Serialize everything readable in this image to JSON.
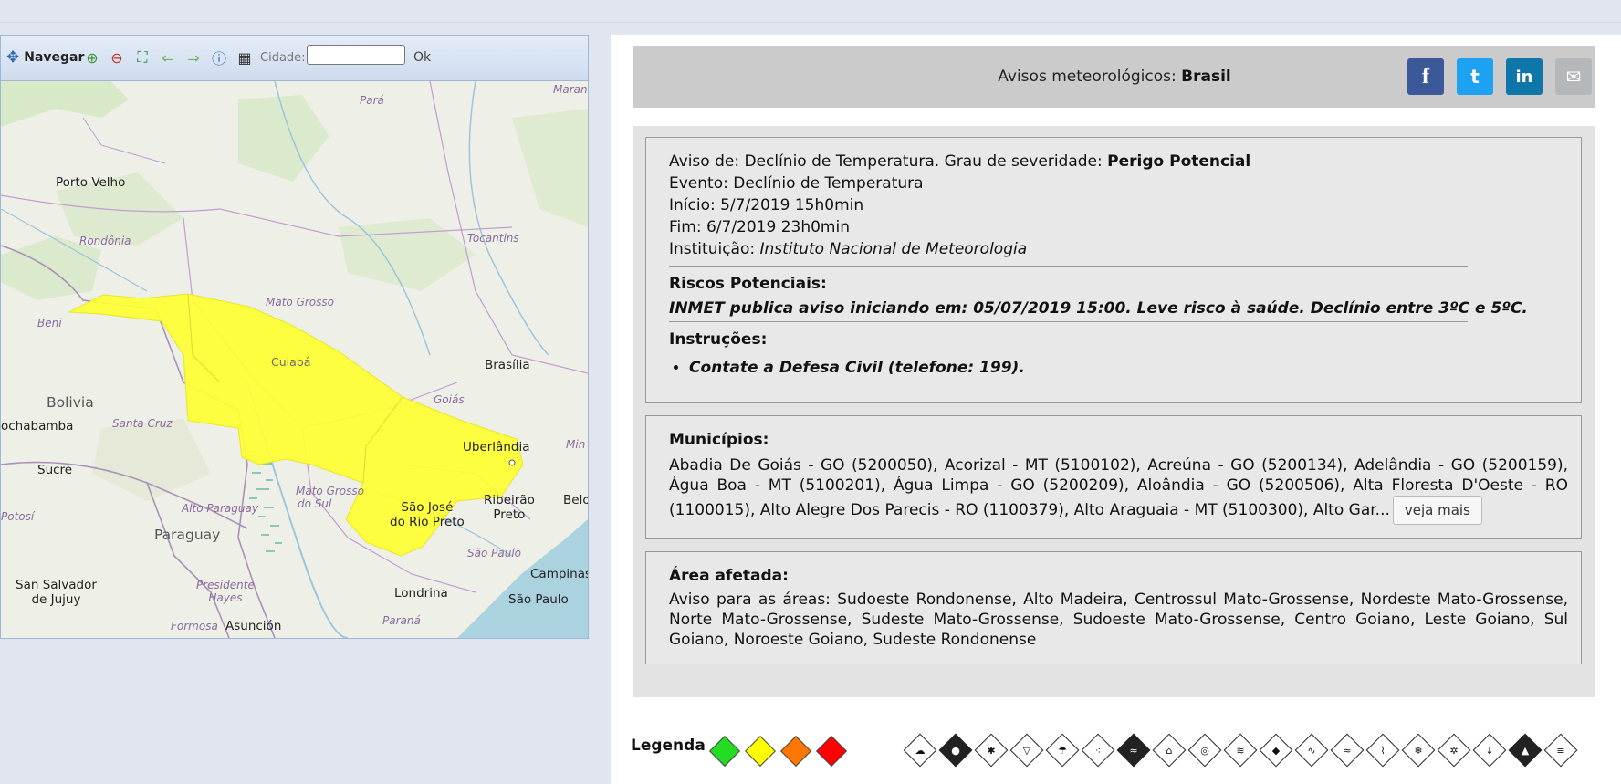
{
  "map": {
    "toolbar": {
      "navegar": "Navegar",
      "cidade_label": "Cidade:",
      "cidade_value": "",
      "ok_label": "Ok"
    },
    "labels": {
      "para": "Pará",
      "maranhao": "Maranh",
      "porto_velho": "Porto Velho",
      "rondonia": "Rondônia",
      "tocantins": "Tocantins",
      "mato_grosso": "Mato Grosso",
      "beni": "Beni",
      "cuiaba": "Cuiabá",
      "brasilia": "Brasília",
      "bolivia": "Bolivia",
      "goias": "Goiás",
      "cochabamba": "ochabamba",
      "santa_cruz": "Santa Cruz",
      "uberlandia": "Uberlândia",
      "minas": "Min",
      "sucre": "Sucre",
      "mato_grosso_do_sul_1": "Mato Grosso",
      "mato_grosso_do_sul_2": "do Sul",
      "ribeirao_1": "Ribeirão",
      "ribeirao_2": "Preto",
      "belo": "Belo",
      "potosi": "Potosí",
      "alto_paraguay": "Alto Paraguay",
      "sao_jose_1": "São José",
      "sao_jose_2": "do Rio Preto",
      "paraguay": "Paraguay",
      "sao_paulo_state": "São Paulo",
      "campinas": "Campinas",
      "san_salvador_1": "San Salvador",
      "san_salvador_2": "de Jujuy",
      "presidente_1": "Presidente",
      "presidente_2": "Hayes",
      "londrina": "Londrina",
      "sao_paulo": "São Paulo",
      "formosa": "Formosa",
      "asuncion": "Asunción",
      "parana": "Paraná"
    }
  },
  "header": {
    "prefix": "Avisos meteorológicos: ",
    "region": "Brasil",
    "share": {
      "facebook": "f",
      "twitter": "t",
      "linkedin": "in",
      "email": "✉"
    }
  },
  "alert": {
    "aviso_prefix": "Aviso de: Declínio de Temperatura. Grau de severidade: ",
    "severity": "Perigo Potencial",
    "evento": "Evento: Declínio de Temperatura",
    "inicio": "Início: 5/7/2019 15h0min",
    "fim": "Fim: 6/7/2019 23h0min",
    "instituicao_label": "Instituição: ",
    "instituicao": "Instituto Nacional de Meteorologia",
    "riscos_title": "Riscos Potenciais:",
    "riscos_text": "INMET publica aviso iniciando em: 05/07/2019 15:00. Leve risco à saúde. Declínio entre 3ºC e 5ºC.",
    "instrucoes_title": "Instruções:",
    "instrucoes_item": "Contate a Defesa Civil (telefone: 199)."
  },
  "municipios": {
    "title": "Municípios:",
    "text": "Abadia De Goiás - GO (5200050), Acorizal - MT (5100102), Acreúna - GO (5200134), Adelândia - GO (5200159), Água Boa - MT (5100201), Água Limpa - GO (5200209), Aloândia - GO (5200506), Alta Floresta D'Oeste - RO (1100015), Alto Alegre Dos Parecis - RO (1100379), Alto Araguaia - MT (5100300), Alto Gar...",
    "veja_mais": "veja mais"
  },
  "area": {
    "title": "Área afetada:",
    "text": "Aviso para as áreas: Sudoeste Rondonense, Alto Madeira, Centrossul Mato-Grossense, Nordeste Mato-Grossense, Norte Mato-Grossense, Sudeste Mato-Grossense, Sudoeste Mato-Grossense, Centro Goiano, Leste Goiano, Sul Goiano, Noroeste Goiano, Sudeste Rondonense"
  },
  "legend": {
    "title": "Legenda",
    "colors": [
      "#22dd22",
      "#ffff00",
      "#ff7700",
      "#ff0000"
    ],
    "icons": [
      "tornado-icon",
      "storm-icon",
      "snow-icon",
      "hail-icon",
      "rain-icon",
      "drizzle-icon",
      "flood-icon",
      "landslide-icon",
      "dry-air-icon",
      "wind-icon",
      "fire-icon",
      "wave-icon",
      "tide-icon",
      "frost-icon",
      "cold-icon",
      "snowfall-icon",
      "temperature-icon",
      "fog-icon",
      "dust-icon"
    ]
  }
}
